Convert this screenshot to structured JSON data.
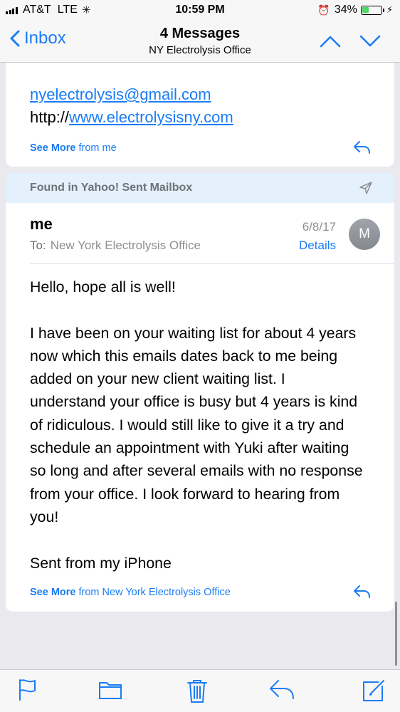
{
  "status_bar": {
    "carrier": "AT&T",
    "network": "LTE",
    "time": "10:59 PM",
    "battery": "34%",
    "battery_level": 0.34
  },
  "nav": {
    "back_label": "Inbox",
    "title": "4 Messages",
    "subtitle": "NY Electrolysis Office"
  },
  "previous_message": {
    "email_link": "nyelectrolysis@gmail.com",
    "url_prefix": "http://",
    "url_link": "www.electrolysisny.com",
    "see_more_label": "See More",
    "see_more_from": "from me"
  },
  "message": {
    "found_in": "Found in Yahoo! Sent Mailbox",
    "sender": "me",
    "to_label": "To:",
    "to_value": "New York Electrolysis Office",
    "date": "6/8/17",
    "details_label": "Details",
    "avatar_initial": "M",
    "greeting": "Hello, hope all is well!",
    "body": "I have been on your waiting list for about 4 years now which this emails dates back to me being added on your new client waiting list. I understand your office is busy but 4 years is kind of ridiculous. I would still like to give it a try and schedule an appointment with Yuki after waiting so long and after several emails with no response from your office. I look forward to hearing from you!",
    "signature": "Sent from my iPhone",
    "see_more_label": "See More",
    "see_more_from": "from New York Electrolysis Office"
  },
  "colors": {
    "accent": "#1a7cf5",
    "found_bar": "#e4f0fb",
    "battery": "#4cd964"
  },
  "toolbar_icons": [
    "flag-icon",
    "folder-icon",
    "trash-icon",
    "reply-icon",
    "compose-icon"
  ]
}
